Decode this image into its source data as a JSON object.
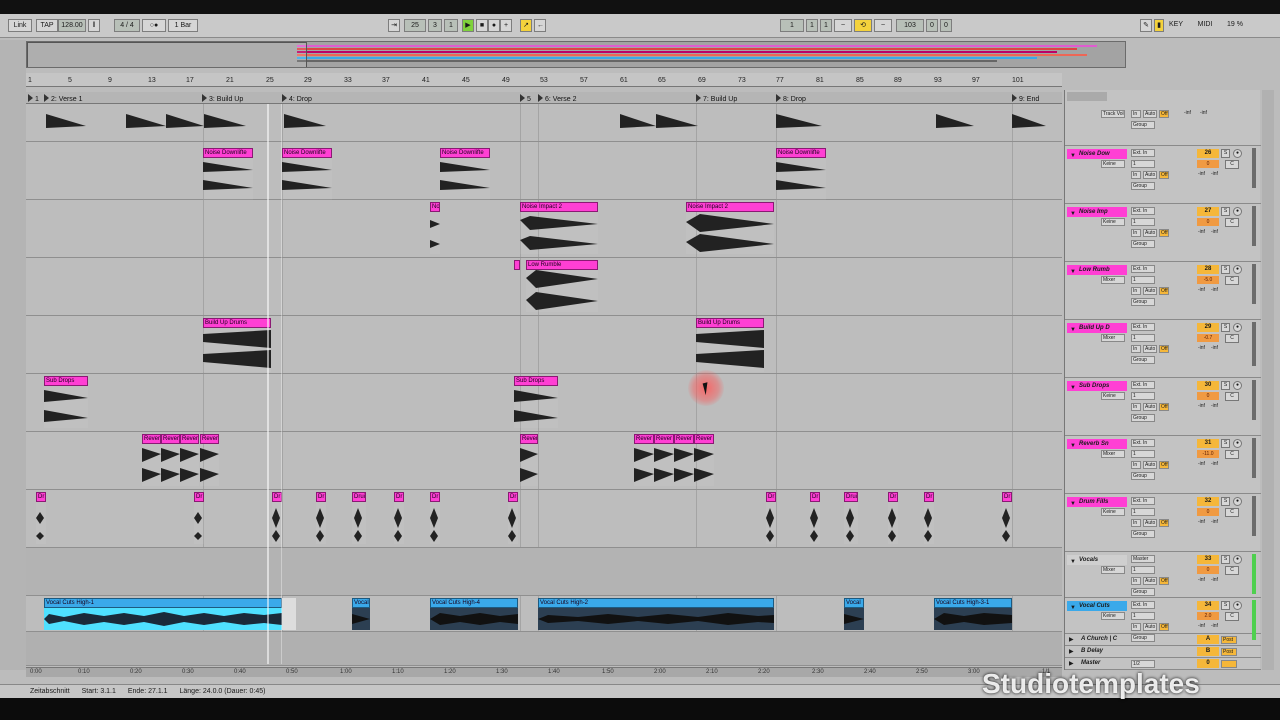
{
  "transport": {
    "link": "Link",
    "tap": "TAP",
    "tempo": "128.00",
    "sig": "4 / 4",
    "quant": "1 Bar",
    "pos1": "25",
    "pos2": "3",
    "pos3": "1",
    "loop1": "1",
    "loop2": "1",
    "loop3": "1",
    "len1": "103",
    "len2": "0",
    "len3": "0",
    "key": "KEY",
    "midi": "MIDI",
    "cpu": "19 %"
  },
  "ruler": [
    "1",
    "5",
    "9",
    "13",
    "17",
    "21",
    "25",
    "29",
    "33",
    "37",
    "41",
    "45",
    "49",
    "53",
    "57",
    "61",
    "65",
    "69",
    "73",
    "77",
    "81",
    "85",
    "89",
    "93",
    "97",
    "101"
  ],
  "locators": [
    "1",
    "2: Verse 1",
    "3: Build Up",
    "4: Drop",
    "5",
    "6: Verse 2",
    "7: Build Up",
    "8: Drop",
    "9: End"
  ],
  "clips": {
    "noise_downlifter": "Noise Downlifte",
    "noise_impact": "Noise Impact 2",
    "noise_impact_short": "No",
    "low_rumble": "Low Rumble",
    "buildup_drums": "Build Up Drums",
    "sub_drops": "Sub Drops",
    "reverb": "Rever",
    "drum_short": "Dr",
    "drum_mid": "Drui",
    "vocal1": "Vocal Cuts High-1",
    "vocal_short": "Vocal",
    "vocal4": "Vocal Cuts High-4",
    "vocal2": "Vocal Cuts High-2",
    "vocal3": "Vocal Cuts High-3-1"
  },
  "mixer": {
    "top_sel": "Track Volum",
    "group": "Group",
    "in": "In",
    "auto": "Auto",
    "off": "Off",
    "inf": "-inf",
    "ext_in": "Ext. In",
    "keine": "Keine",
    "mixer": "Mixer",
    "master": "Master",
    "one": "1",
    "c": "C",
    "s": "S",
    "a_church": "A Church | C",
    "half": "1/2",
    "tracks": [
      {
        "name": "Noise Dow",
        "num": "26",
        "vol": "0"
      },
      {
        "name": "Noise Imp",
        "num": "27",
        "vol": "0"
      },
      {
        "name": "Low Rumb",
        "num": "28",
        "vol": "-5.0"
      },
      {
        "name": "Build Up D",
        "num": "29",
        "vol": "-0.7"
      },
      {
        "name": "Sub Drops",
        "num": "30",
        "vol": "0"
      },
      {
        "name": "Reverb Sn",
        "num": "31",
        "vol": "-11.0"
      },
      {
        "name": "Drum Fills",
        "num": "32",
        "vol": "0"
      },
      {
        "name": "Vocals",
        "num": "33",
        "vol": "0"
      },
      {
        "name": "Vocal Cuts",
        "num": "34",
        "vol": "2.0"
      }
    ],
    "returns": [
      {
        "name": "A Church | C",
        "btn": "A",
        "post": "Post"
      },
      {
        "name": "B Delay",
        "btn": "B",
        "post": "Post"
      },
      {
        "name": "Master",
        "btn": "0",
        "post": ""
      }
    ]
  },
  "timeline": [
    "0:00",
    "0:10",
    "0:20",
    "0:30",
    "0:40",
    "0:50",
    "1:00",
    "1:10",
    "1:20",
    "1:30",
    "1:40",
    "1:50",
    "2:00",
    "2:10",
    "2:20",
    "2:30",
    "2:40",
    "2:50",
    "3:00"
  ],
  "pager": "1/1",
  "status": {
    "label": "Zeitabschnitt",
    "start": "Start: 3.1.1",
    "end": "Ende: 27.1.1",
    "length": "Länge: 24.0.0 (Dauer: 0:45)"
  },
  "watermark": "Studiotemplates"
}
